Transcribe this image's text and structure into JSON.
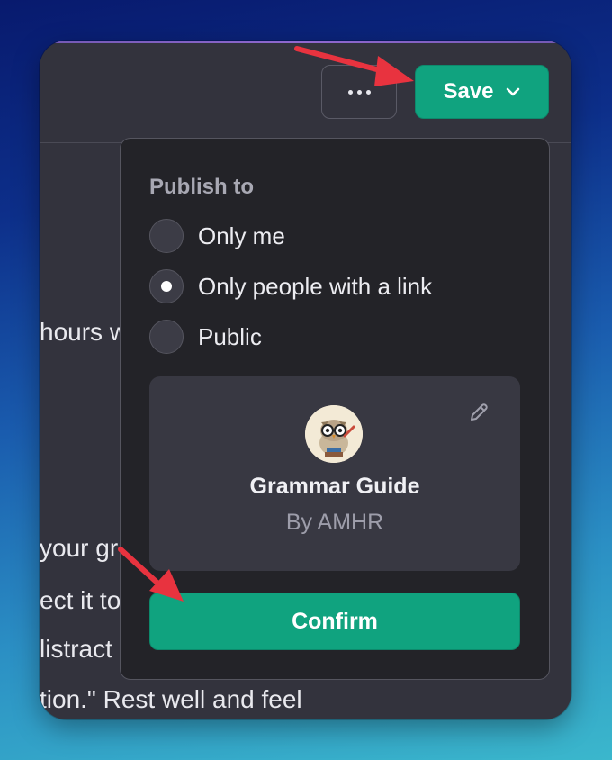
{
  "header": {
    "more_icon": "ellipsis-icon",
    "save_label": "Save",
    "save_chevron_icon": "chevron-down-icon"
  },
  "background_text": {
    "line1": "hours w",
    "line2": "your gr",
    "line3": "ect it to",
    "line4": "listract",
    "line5": "tion.\" Rest well and feel"
  },
  "publish_popup": {
    "heading": "Publish to",
    "options": [
      {
        "label": "Only me",
        "selected": false
      },
      {
        "label": "Only people with a link",
        "selected": true
      },
      {
        "label": "Public",
        "selected": false
      }
    ],
    "gpt_card": {
      "name": "Grammar Guide",
      "author": "By AMHR",
      "avatar_icon": "owl-avatar-icon",
      "edit_icon": "pencil-icon"
    },
    "confirm_label": "Confirm"
  },
  "colors": {
    "accent_green": "#10a37f",
    "annotation_red": "#e8333f",
    "panel_bg": "#232328",
    "window_bg": "#33333d"
  }
}
